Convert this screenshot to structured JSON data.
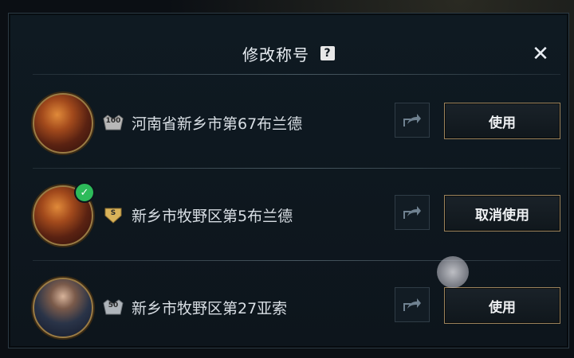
{
  "dialog": {
    "title": "修改称号",
    "help_glyph": "?",
    "close_glyph": "✕"
  },
  "titles": [
    {
      "rank_badge": "100",
      "rank_color": "#b8b8b8",
      "name": "河南省新乡市第67布兰德",
      "action": "使用",
      "active": false,
      "avatar": "fire"
    },
    {
      "rank_badge": "S",
      "rank_color": "#d9b35a",
      "name": "新乡市牧野区第5布兰德",
      "action": "取消使用",
      "active": true,
      "avatar": "fire"
    },
    {
      "rank_badge": "50",
      "rank_color": "#aeb4ba",
      "name": "新乡市牧野区第27亚索",
      "action": "使用",
      "active": false,
      "avatar": "dark"
    }
  ],
  "icons": {
    "share": "share-icon",
    "check": "check-icon",
    "help": "help-icon",
    "close": "close-icon"
  }
}
